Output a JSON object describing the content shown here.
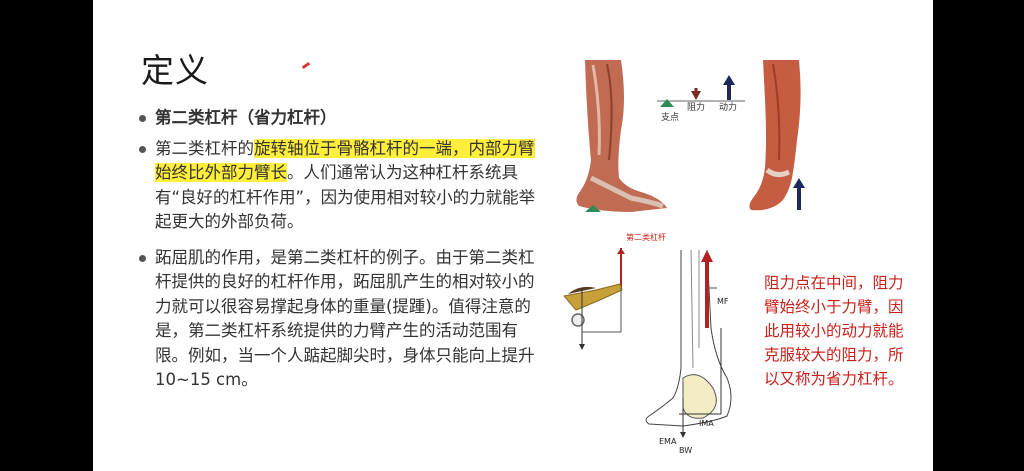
{
  "slide": {
    "title": "定义",
    "bullets": [
      {
        "text": "第二类杠杆（省力杠杆）"
      },
      {
        "pre": "第二类杠杆的",
        "highlight": "旋转轴位于骨骼杠杆的一端，内部力臂始终比外部力臂长",
        "post": "。人们通常认为这种杠杆系统具有“良好的杠杆作用”，因为使用相对较小的力就能举起更大的外部负荷。"
      },
      {
        "text": "跖屈肌的作用，是第二类杠杆的例子。由于第二类杠杆提供的良好的杠杆作用，跖屈肌产生的相对较小的力就可以很容易撑起身体的重量(提踵)。值得注意的是，第二类杠杆系统提供的力臂产生的活动范围有限。例如，当一个人踮起脚尖时，身体只能向上提升10~15 cm。"
      }
    ],
    "lever_diagram": {
      "fulcrum": "支点",
      "resistance": "阻力",
      "effort": "动力"
    },
    "figure_caption": "第二类杠杆",
    "foot_labels": {
      "mf": "MF",
      "ima": "IMA",
      "ema": "EMA",
      "bw": "BW"
    },
    "red_note": "阻力点在中间，阻力臂始终小于力臂，因此用较小的动力就能克服较大的阻力，所以又称为省力杠杆。"
  },
  "colors": {
    "highlight": "#ffef3a",
    "note_red": "#c8201b",
    "fulcrum_green": "#2e8b57",
    "effort_navy": "#1f2a5a",
    "resistance_brown": "#7a2a1f"
  }
}
